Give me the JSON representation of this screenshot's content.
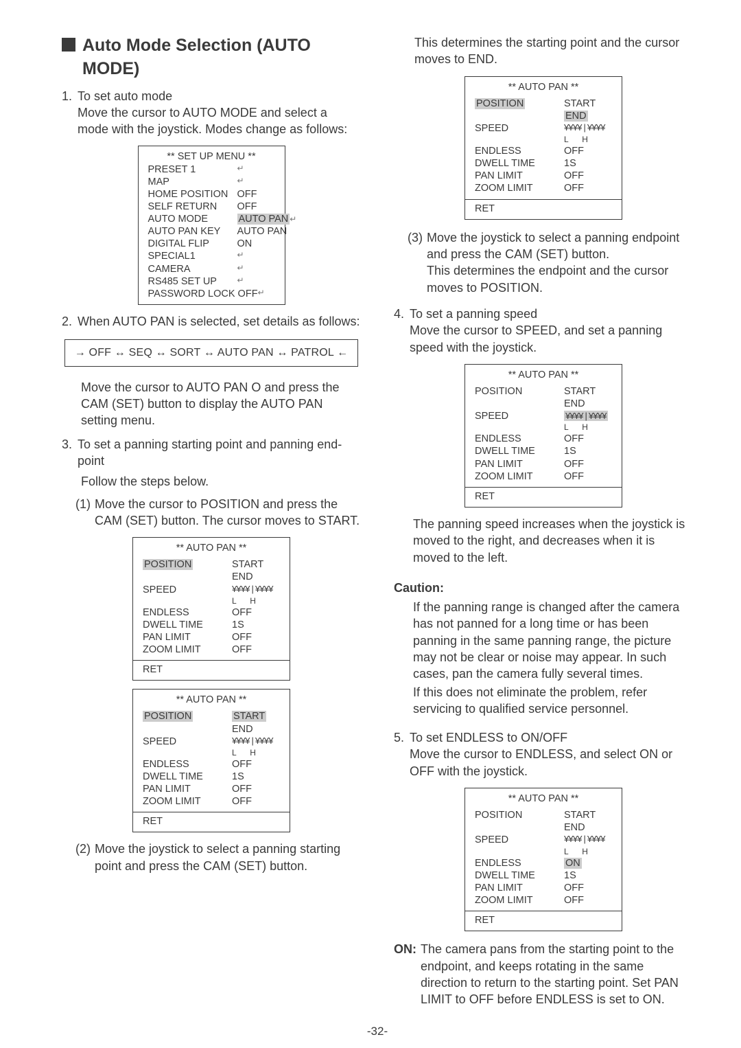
{
  "title_line1": "Auto Mode Selection (AUTO",
  "title_line2": "MODE)",
  "steps": {
    "s1_num": "1.",
    "s1_head": "To set auto mode",
    "s1_body": "Move the cursor to AUTO MODE and select a mode with the joystick. Modes change as follows:",
    "s2_num": "2.",
    "s2_body": "When AUTO PAN is selected, set details as follows:",
    "chain": "OFF ↔ SEQ ↔ SORT ↔ AUTO PAN ↔ PATROL",
    "s2_para": "Move the cursor to AUTO PAN O  and press the CAM (SET) button to display the AUTO PAN setting menu.",
    "s3_num": "3.",
    "s3_head": "To set a panning starting point and panning end-point",
    "s3_follow": "Follow the steps below.",
    "sub1_num": "(1)",
    "sub1_body": "Move the cursor to POSITION and press the CAM (SET) button. The cursor moves to START.",
    "sub2_num": "(2)",
    "sub2_body": "Move the joystick to select a panning starting point and press the CAM (SET) button.",
    "r_top": "This determines the starting point and the cursor moves to END.",
    "sub3_num": "(3)",
    "sub3_body1": "Move the joystick to select a panning endpoint and press the CAM (SET) button.",
    "sub3_body2": "This determines the endpoint and the cursor moves to POSITION.",
    "s4_num": "4.",
    "s4_head": "To set a panning speed",
    "s4_body": "Move the cursor to SPEED, and set a panning speed with the joystick.",
    "s4_after": "The panning speed increases when the joystick is moved to the right, and decreases when it is moved to the left.",
    "caution_hd": "Caution:",
    "caution_body1": "If the panning range is changed after the camera has not panned for a long time or has been panning in the same panning range, the picture may not be clear or noise may appear. In such cases, pan the camera fully several times.",
    "caution_body2": "If this does not eliminate the problem, refer servicing to qualified service personnel.",
    "s5_num": "5.",
    "s5_head": "To set ENDLESS to ON/OFF",
    "s5_body": "Move the cursor to ENDLESS, and select ON or OFF with the joystick.",
    "on_label": "ON:",
    "on_body": "The camera pans from the starting point to the endpoint, and keeps rotating in the same direction to return to the starting point. Set PAN LIMIT to OFF before ENDLESS is set to ON."
  },
  "setup_menu": {
    "title": "** SET UP MENU **",
    "rows": [
      [
        "PRESET 1 ",
        ""
      ],
      [
        "MAP ",
        ""
      ],
      [
        "HOME POSITION",
        "OFF"
      ],
      [
        "SELF RETURN",
        "OFF"
      ],
      [
        "AUTO MODE",
        "AUTO PAN"
      ],
      [
        "AUTO PAN KEY",
        "AUTO PAN"
      ],
      [
        "DIGITAL FLIP",
        "ON"
      ],
      [
        "SPECIAL1 ",
        ""
      ],
      [
        "CAMERA",
        ""
      ],
      [
        "RS485 SET UP ",
        ""
      ],
      [
        "PASSWORD LOCK OFF",
        ""
      ]
    ],
    "highlight_value_row": 4
  },
  "autopan_menu": {
    "title": "** AUTO PAN **",
    "labels": {
      "position": "POSITION",
      "speed": "SPEED",
      "endless": "ENDLESS",
      "dwell": "DWELL TIME",
      "panlimit": "PAN LIMIT",
      "zoomlimit": "ZOOM LIMIT",
      "ret": "RET"
    },
    "values": {
      "start": "START",
      "end": "END",
      "speed_display": "¥¥¥¥ | ¥¥¥¥",
      "speed_lh": "L      H",
      "off": "OFF",
      "on": "ON",
      "one_s": "1S"
    }
  },
  "page_num": "-32-"
}
